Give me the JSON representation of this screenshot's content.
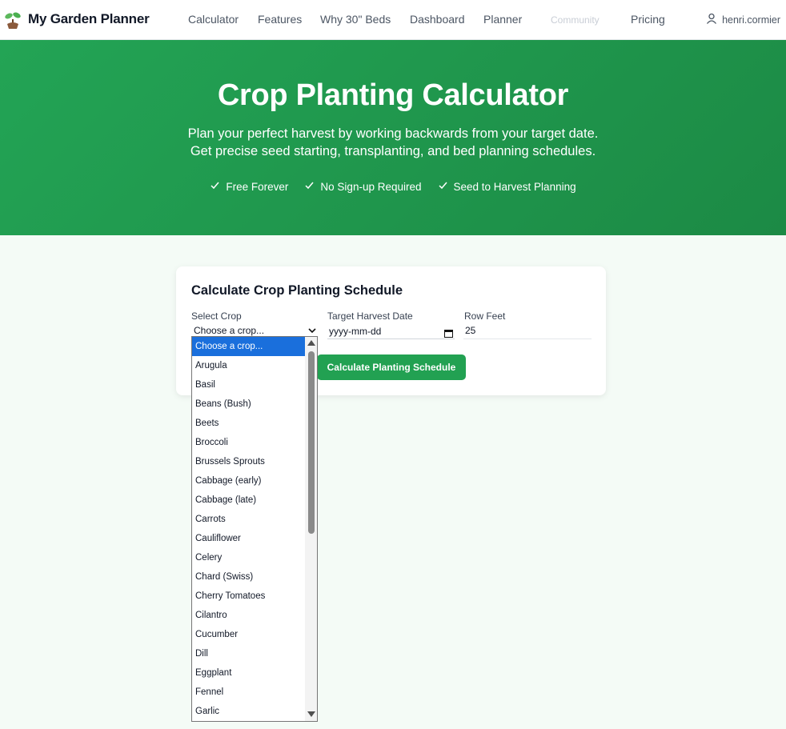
{
  "nav": {
    "brand": "My Garden Planner",
    "logo_icon": "seedling-icon",
    "links": [
      "Calculator",
      "Features",
      "Why 30\" Beds",
      "Dashboard",
      "Planner",
      "Community",
      "Pricing"
    ],
    "user": "henri.cormier",
    "user_icon": "user-icon"
  },
  "hero": {
    "title": "Crop Planting Calculator",
    "subtitle_1": "Plan your perfect harvest by working backwards from your target date.",
    "subtitle_2": "Get precise seed starting, transplanting, and bed planning schedules.",
    "features": [
      "Free Forever",
      "No Sign-up Required",
      "Seed to Harvest Planning"
    ],
    "colors": {
      "start": "#23a455",
      "end": "#1c8a45"
    }
  },
  "form": {
    "title": "Calculate Crop Planting Schedule",
    "crop_label": "Select Crop",
    "crop_value": "Choose a crop...",
    "date_label": "Target Harvest Date",
    "date_placeholder": "yyyy-mm-dd",
    "rows_label": "Row Feet",
    "rows_value": "25",
    "button": "Calculate Planting Schedule",
    "accent": "#22a152"
  },
  "dropdown": {
    "selected": "Choose a crop...",
    "options": [
      "Choose a crop...",
      "Arugula",
      "Basil",
      "Beans (Bush)",
      "Beets",
      "Broccoli",
      "Brussels Sprouts",
      "Cabbage (early)",
      "Cabbage (late)",
      "Carrots",
      "Cauliflower",
      "Celery",
      "Chard (Swiss)",
      "Cherry Tomatoes",
      "Cilantro",
      "Cucumber",
      "Dill",
      "Eggplant",
      "Fennel",
      "Garlic"
    ]
  }
}
